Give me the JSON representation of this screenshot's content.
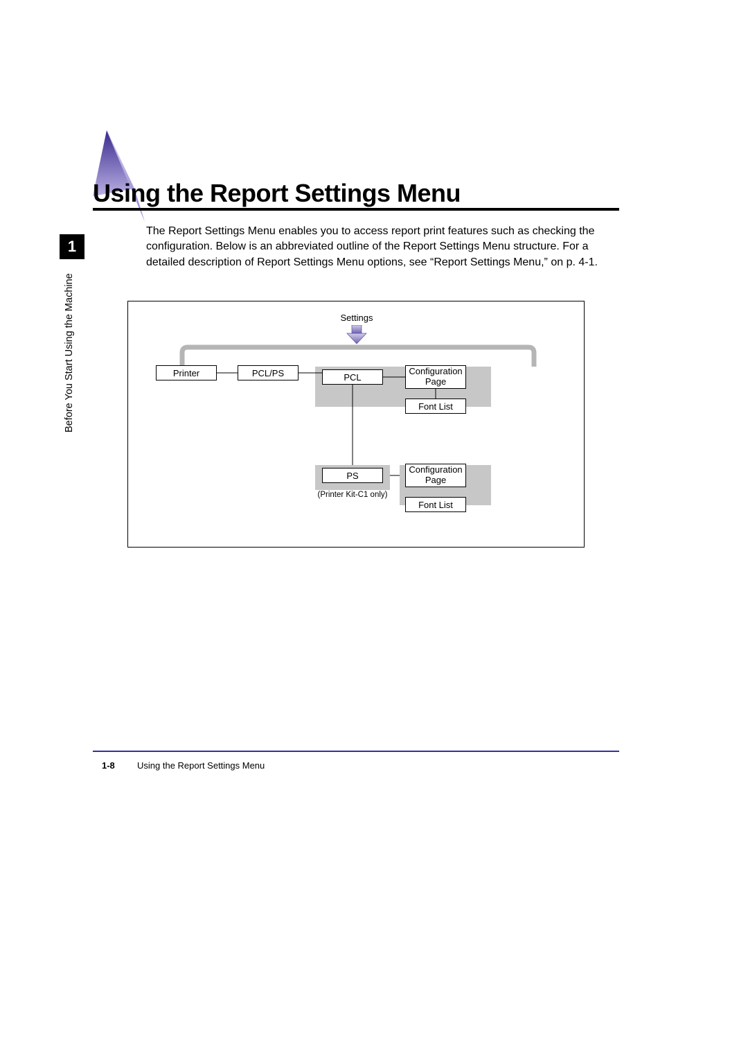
{
  "chapter": {
    "tab_number": "1",
    "sidebar_label": "Before You Start Using the Machine"
  },
  "heading": "Using the Report Settings Menu",
  "paragraph": "The Report Settings Menu enables you to access report print features such as checking the configuration. Below is an abbreviated outline of the Report Settings Menu structure. For a detailed description of Report Settings Menu options, see “Report Settings Menu,” on p. 4-1.",
  "diagram": {
    "top_label": "Settings",
    "nodes": {
      "printer": "Printer",
      "pclps": "PCL/PS",
      "pcl": "PCL",
      "pcl_config": "Configuration Page",
      "pcl_fontlist": "Font List",
      "ps": "PS",
      "ps_note": "(Printer Kit-C1 only)",
      "ps_config": "Configuration Page",
      "ps_fontlist": "Font List"
    }
  },
  "footer": {
    "page_number": "1-8",
    "title": "Using the Report Settings Menu"
  }
}
